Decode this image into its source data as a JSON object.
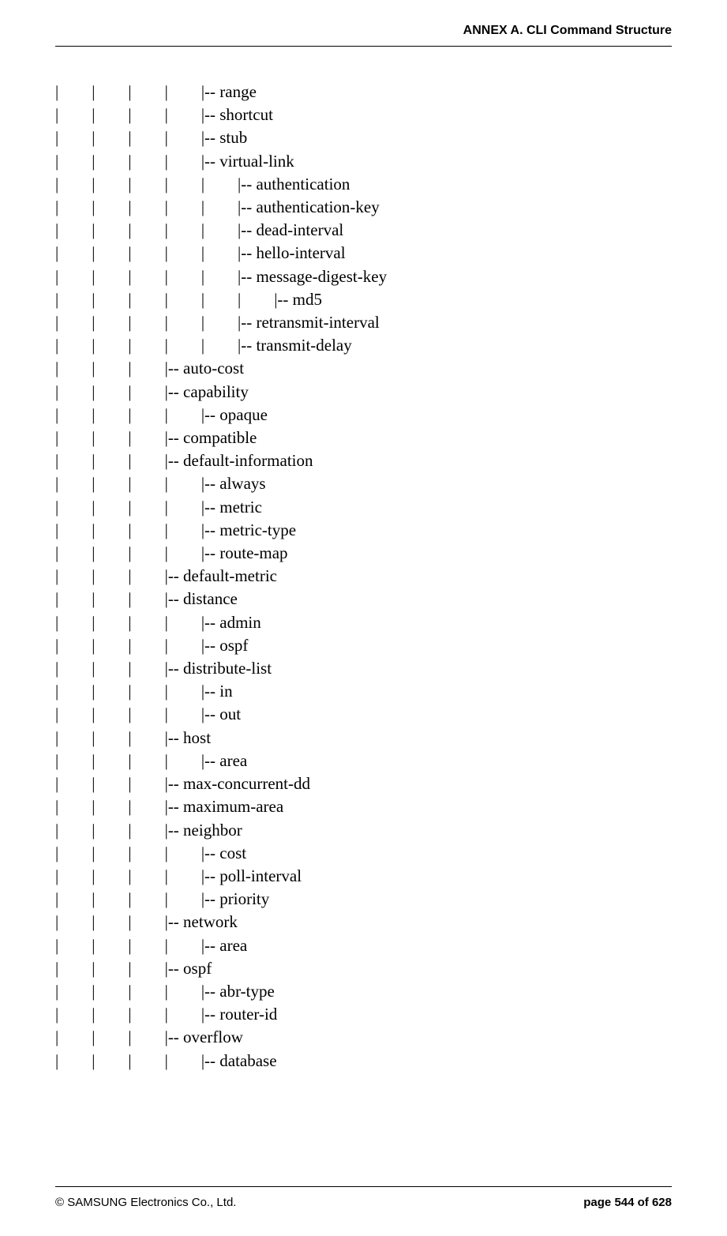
{
  "header": {
    "title": "ANNEX A. CLI Command Structure"
  },
  "lines": [
    "|        |        |        |        |-- range",
    "|        |        |        |        |-- shortcut",
    "|        |        |        |        |-- stub",
    "|        |        |        |        |-- virtual-link",
    "|        |        |        |        |        |-- authentication",
    "|        |        |        |        |        |-- authentication-key",
    "|        |        |        |        |        |-- dead-interval",
    "|        |        |        |        |        |-- hello-interval",
    "|        |        |        |        |        |-- message-digest-key",
    "|        |        |        |        |        |        |-- md5",
    "|        |        |        |        |        |-- retransmit-interval",
    "|        |        |        |        |        |-- transmit-delay",
    "|        |        |        |-- auto-cost",
    "|        |        |        |-- capability",
    "|        |        |        |        |-- opaque",
    "|        |        |        |-- compatible",
    "|        |        |        |-- default-information",
    "|        |        |        |        |-- always",
    "|        |        |        |        |-- metric",
    "|        |        |        |        |-- metric-type",
    "|        |        |        |        |-- route-map",
    "|        |        |        |-- default-metric",
    "|        |        |        |-- distance",
    "|        |        |        |        |-- admin",
    "|        |        |        |        |-- ospf",
    "|        |        |        |-- distribute-list",
    "|        |        |        |        |-- in",
    "|        |        |        |        |-- out",
    "|        |        |        |-- host",
    "|        |        |        |        |-- area",
    "|        |        |        |-- max-concurrent-dd",
    "|        |        |        |-- maximum-area",
    "|        |        |        |-- neighbor",
    "|        |        |        |        |-- cost",
    "|        |        |        |        |-- poll-interval",
    "|        |        |        |        |-- priority",
    "|        |        |        |-- network",
    "|        |        |        |        |-- area",
    "|        |        |        |-- ospf",
    "|        |        |        |        |-- abr-type",
    "|        |        |        |        |-- router-id",
    "|        |        |        |-- overflow",
    "|        |        |        |        |-- database"
  ],
  "footer": {
    "copyright": "© SAMSUNG Electronics Co., Ltd.",
    "page": "page 544 of 628"
  }
}
